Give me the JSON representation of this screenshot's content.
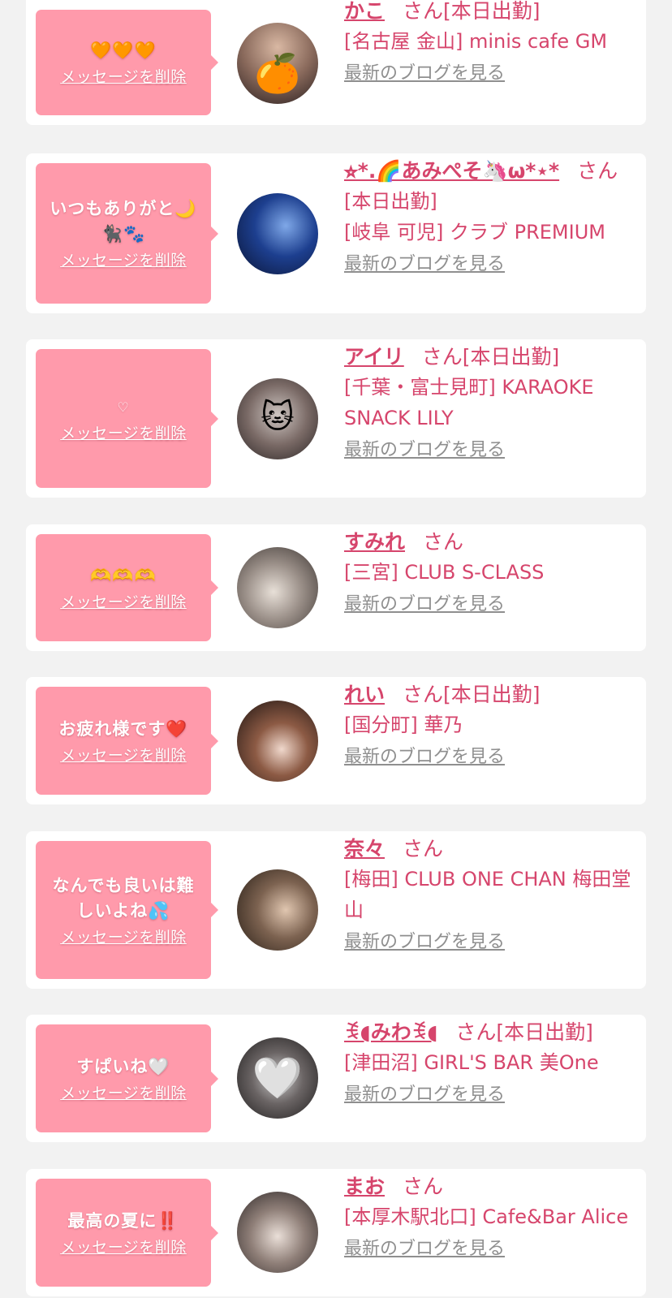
{
  "delete_label": "メッセージを削除",
  "blog_label": "最新のブログを見る",
  "colors": {
    "accent": "#d6456c",
    "bubble": "#ff9aab",
    "link_gray": "#8f8f8f",
    "background": "#f2f2f2"
  },
  "entries": [
    {
      "message": "🧡🧡🧡",
      "name": "かこ",
      "suffix": "さん[本日出勤]",
      "shop": "[名古屋 金山] minis cafe GM",
      "avatar_icon": "orange-emoji-icon",
      "avatar_mask": "🍊"
    },
    {
      "message": "いつもありがと🌙\n🐈‍⬛🐾",
      "name": "⭐︎*.🌈あみぺそ🦄ω*⋆*",
      "suffix": "さん",
      "status": "[本日出勤]",
      "shop": "[岐阜 可児] クラブ PREMIUM",
      "avatar_icon": "",
      "avatar_mask": ""
    },
    {
      "message": "♡",
      "name": "アイリ",
      "suffix": "さん[本日出勤]",
      "shop": "[千葉・富士見町] KARAOKE SNACK LILY",
      "avatar_icon": "cat-face-emoji-icon",
      "avatar_mask": "🐱"
    },
    {
      "message": "🫶🫶🫶",
      "name": "すみれ",
      "suffix": "さん",
      "shop": "[三宮] CLUB S-CLASS",
      "avatar_icon": "",
      "avatar_mask": ""
    },
    {
      "message": "お疲れ様です❤️",
      "name": "れい",
      "suffix": "さん[本日出勤]",
      "shop": "[国分町] 華乃",
      "avatar_icon": "",
      "avatar_mask": ""
    },
    {
      "message": "なんでも良いは難\nしいよね💦",
      "name": "奈々",
      "suffix": "さん",
      "shop": "[梅田] CLUB ONE CHAN 梅田堂山",
      "avatar_icon": "",
      "avatar_mask": ""
    },
    {
      "message": "すぱいね🤍",
      "name": "ꉂ◖みわꉂ◖",
      "suffix": "さん[本日出勤]",
      "shop": "[津田沼] GIRL'S BAR 美One",
      "avatar_icon": "white-heart-icon",
      "avatar_mask": "🤍"
    },
    {
      "message": "最高の夏に‼️",
      "name": "まお",
      "suffix": "さん",
      "shop": "[本厚木駅北口] Cafe&Bar Alice",
      "avatar_icon": "",
      "avatar_mask": ""
    }
  ]
}
